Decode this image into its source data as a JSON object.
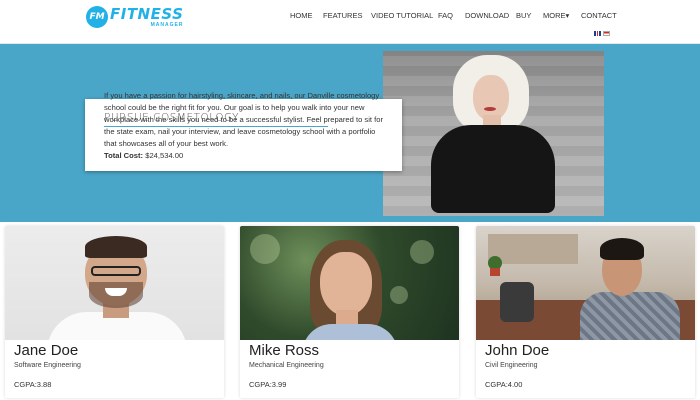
{
  "brand": {
    "badge": "FM",
    "name": "FITNESS",
    "tagline": "MANAGER"
  },
  "nav": {
    "items": [
      "HOME",
      "FEATURES",
      "VIDEO TUTORIAL",
      "FAQ",
      "DOWNLOAD",
      "BUY",
      "MORE▾",
      "CONTACT"
    ]
  },
  "hero": {
    "title": "PURSUE COSMETOLOGY",
    "body": "If you have a passion for hairstyling, skincare, and nails, our Danville cosmetology school could be the right fit for you. Our goal is to help you walk into your new workplace with the skills you need to be a successful stylist. Feel prepared to sit for the state exam, nail your interview, and leave cosmetology school with a portfolio that showcases all of your best work.",
    "cost_label": "Total Cost:",
    "cost_value": "$24,534.00"
  },
  "profiles": [
    {
      "name": "Jane Doe",
      "role": "Software Engineering",
      "cgpa": "CGPA:3.88"
    },
    {
      "name": "Mike Ross",
      "role": "Mechanical Engineering",
      "cgpa": "CGPA:3.99"
    },
    {
      "name": "John Doe",
      "role": "Civil Engineering",
      "cgpa": "CGPA:4.00"
    }
  ]
}
